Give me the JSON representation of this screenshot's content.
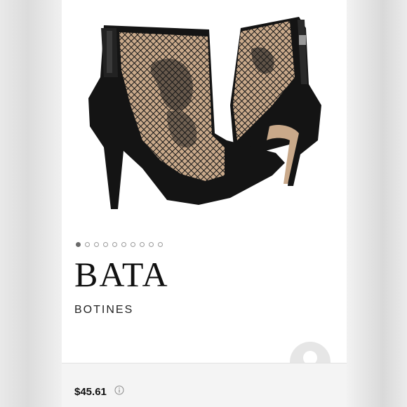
{
  "listing": {
    "brand": "BATA",
    "category": "BOTINES",
    "price": "$45.61"
  },
  "gallery": {
    "total_images": 10,
    "active_index": 0
  },
  "colors": {
    "boot_black": "#141414",
    "lace_skin": "#c9a98a",
    "background": "#ffffff"
  },
  "icons": {
    "info": "info-icon",
    "avatar": "user-avatar-icon"
  }
}
